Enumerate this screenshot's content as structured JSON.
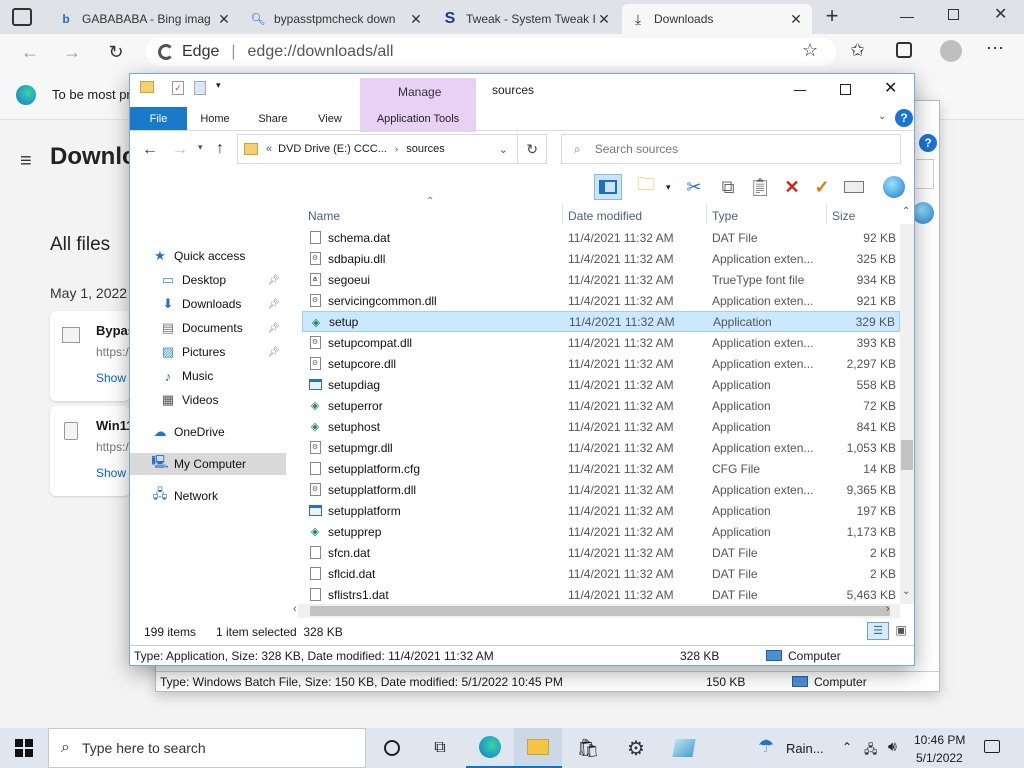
{
  "browser": {
    "tabs": [
      {
        "title": "GABABABA - Bing imag",
        "icon": "bing-icon"
      },
      {
        "title": "bypasstpmcheck down",
        "icon": "search-icon"
      },
      {
        "title": "Tweak - System Tweak I",
        "icon": "tweak-s-icon"
      },
      {
        "title": "Downloads",
        "icon": "download-icon",
        "active": true
      }
    ],
    "address_site": "Edge",
    "address_url": "edge://downloads/all",
    "infobar_text": "To be most pr"
  },
  "downloads_page": {
    "title": "Downlo",
    "section": "All files",
    "date": "May 1, 2022",
    "items": [
      {
        "name": "Bypas",
        "url": "https:/",
        "action": "Show"
      },
      {
        "name": "Win11",
        "url": "https:/",
        "action": "Show"
      }
    ]
  },
  "behind_window": {
    "status_text": "Type: Windows Batch File, Size: 150 KB, Date modified: 5/1/2022 10:45 PM",
    "status_size": "150 KB",
    "status_location": "Computer"
  },
  "explorer": {
    "title": "sources",
    "manage_label": "Manage",
    "ribbon_tabs": [
      "File",
      "Home",
      "Share",
      "View",
      "Application Tools"
    ],
    "breadcrumb_prefix": "«",
    "breadcrumb": [
      "DVD Drive (E:) CCC...",
      "sources"
    ],
    "search_placeholder": "Search sources",
    "columns": {
      "name": "Name",
      "date": "Date modified",
      "type": "Type",
      "size": "Size"
    },
    "nav": [
      {
        "label": "Quick access",
        "icon": "star-icon",
        "color": "#1e73d8",
        "indent": 0
      },
      {
        "label": "Desktop",
        "icon": "desktop-icon",
        "color": "#3a8ee6",
        "indent": 1,
        "pinned": true
      },
      {
        "label": "Downloads",
        "icon": "downloads-icon",
        "color": "#2a6ecb",
        "indent": 1,
        "pinned": true
      },
      {
        "label": "Documents",
        "icon": "documents-icon",
        "color": "#777777",
        "indent": 1,
        "pinned": true
      },
      {
        "label": "Pictures",
        "icon": "pictures-icon",
        "color": "#3a8ee6",
        "indent": 1,
        "pinned": true
      },
      {
        "label": "Music",
        "icon": "music-icon",
        "color": "#2a6ecb",
        "indent": 1
      },
      {
        "label": "Videos",
        "icon": "videos-icon",
        "color": "#555555",
        "indent": 1
      },
      {
        "label": "OneDrive",
        "icon": "cloud-icon",
        "color": "#1e73d8",
        "indent": 0
      },
      {
        "label": "My Computer",
        "icon": "computer-icon",
        "color": "#2a6ecb",
        "indent": 0,
        "selected": true
      },
      {
        "label": "Network",
        "icon": "network-icon",
        "color": "#2a6ecb",
        "indent": 0
      }
    ],
    "files": [
      {
        "name": "schema.dat",
        "date": "11/4/2021 11:32 AM",
        "type": "DAT File",
        "size": "92 KB",
        "icon": "document-icon"
      },
      {
        "name": "sdbapiu.dll",
        "date": "11/4/2021 11:32 AM",
        "type": "Application exten...",
        "size": "325 KB",
        "icon": "dll-icon"
      },
      {
        "name": "segoeui",
        "date": "11/4/2021 11:32 AM",
        "type": "TrueType font file",
        "size": "934 KB",
        "icon": "font-icon"
      },
      {
        "name": "servicingcommon.dll",
        "date": "11/4/2021 11:32 AM",
        "type": "Application exten...",
        "size": "921 KB",
        "icon": "dll-icon"
      },
      {
        "name": "setup",
        "date": "11/4/2021 11:32 AM",
        "type": "Application",
        "size": "329 KB",
        "icon": "setup-app-icon",
        "selected": true
      },
      {
        "name": "setupcompat.dll",
        "date": "11/4/2021 11:32 AM",
        "type": "Application exten...",
        "size": "393 KB",
        "icon": "dll-icon"
      },
      {
        "name": "setupcore.dll",
        "date": "11/4/2021 11:32 AM",
        "type": "Application exten...",
        "size": "2,297 KB",
        "icon": "dll-icon"
      },
      {
        "name": "setupdiag",
        "date": "11/4/2021 11:32 AM",
        "type": "Application",
        "size": "558 KB",
        "icon": "app-window-icon"
      },
      {
        "name": "setuperror",
        "date": "11/4/2021 11:32 AM",
        "type": "Application",
        "size": "72 KB",
        "icon": "setup-app-icon"
      },
      {
        "name": "setuphost",
        "date": "11/4/2021 11:32 AM",
        "type": "Application",
        "size": "841 KB",
        "icon": "setup-app-icon"
      },
      {
        "name": "setupmgr.dll",
        "date": "11/4/2021 11:32 AM",
        "type": "Application exten...",
        "size": "1,053 KB",
        "icon": "dll-icon"
      },
      {
        "name": "setupplatform.cfg",
        "date": "11/4/2021 11:32 AM",
        "type": "CFG File",
        "size": "14 KB",
        "icon": "document-icon"
      },
      {
        "name": "setupplatform.dll",
        "date": "11/4/2021 11:32 AM",
        "type": "Application exten...",
        "size": "9,365 KB",
        "icon": "dll-icon"
      },
      {
        "name": "setupplatform",
        "date": "11/4/2021 11:32 AM",
        "type": "Application",
        "size": "197 KB",
        "icon": "app-window-icon"
      },
      {
        "name": "setupprep",
        "date": "11/4/2021 11:32 AM",
        "type": "Application",
        "size": "1,173 KB",
        "icon": "setup-app-icon"
      },
      {
        "name": "sfcn.dat",
        "date": "11/4/2021 11:32 AM",
        "type": "DAT File",
        "size": "2 KB",
        "icon": "document-icon"
      },
      {
        "name": "sflcid.dat",
        "date": "11/4/2021 11:32 AM",
        "type": "DAT File",
        "size": "2 KB",
        "icon": "document-icon"
      },
      {
        "name": "sflistrs1.dat",
        "date": "11/4/2021 11:32 AM",
        "type": "DAT File",
        "size": "5,463 KB",
        "icon": "document-icon"
      }
    ],
    "item_count": "199 items",
    "selection_info": "1 item selected  328 KB",
    "status_text": "Type: Application, Size: 328 KB, Date modified: 11/4/2021 11:32 AM",
    "status_size": "328 KB",
    "status_location": "Computer"
  },
  "taskbar": {
    "search_placeholder": "Type here to search",
    "weather": "Rain...",
    "time": "10:46 PM",
    "date": "5/1/2022"
  },
  "colors": {
    "accent": "#0078d4",
    "selection": "#cce8ff",
    "manage_tab": "#e9d1f5"
  }
}
